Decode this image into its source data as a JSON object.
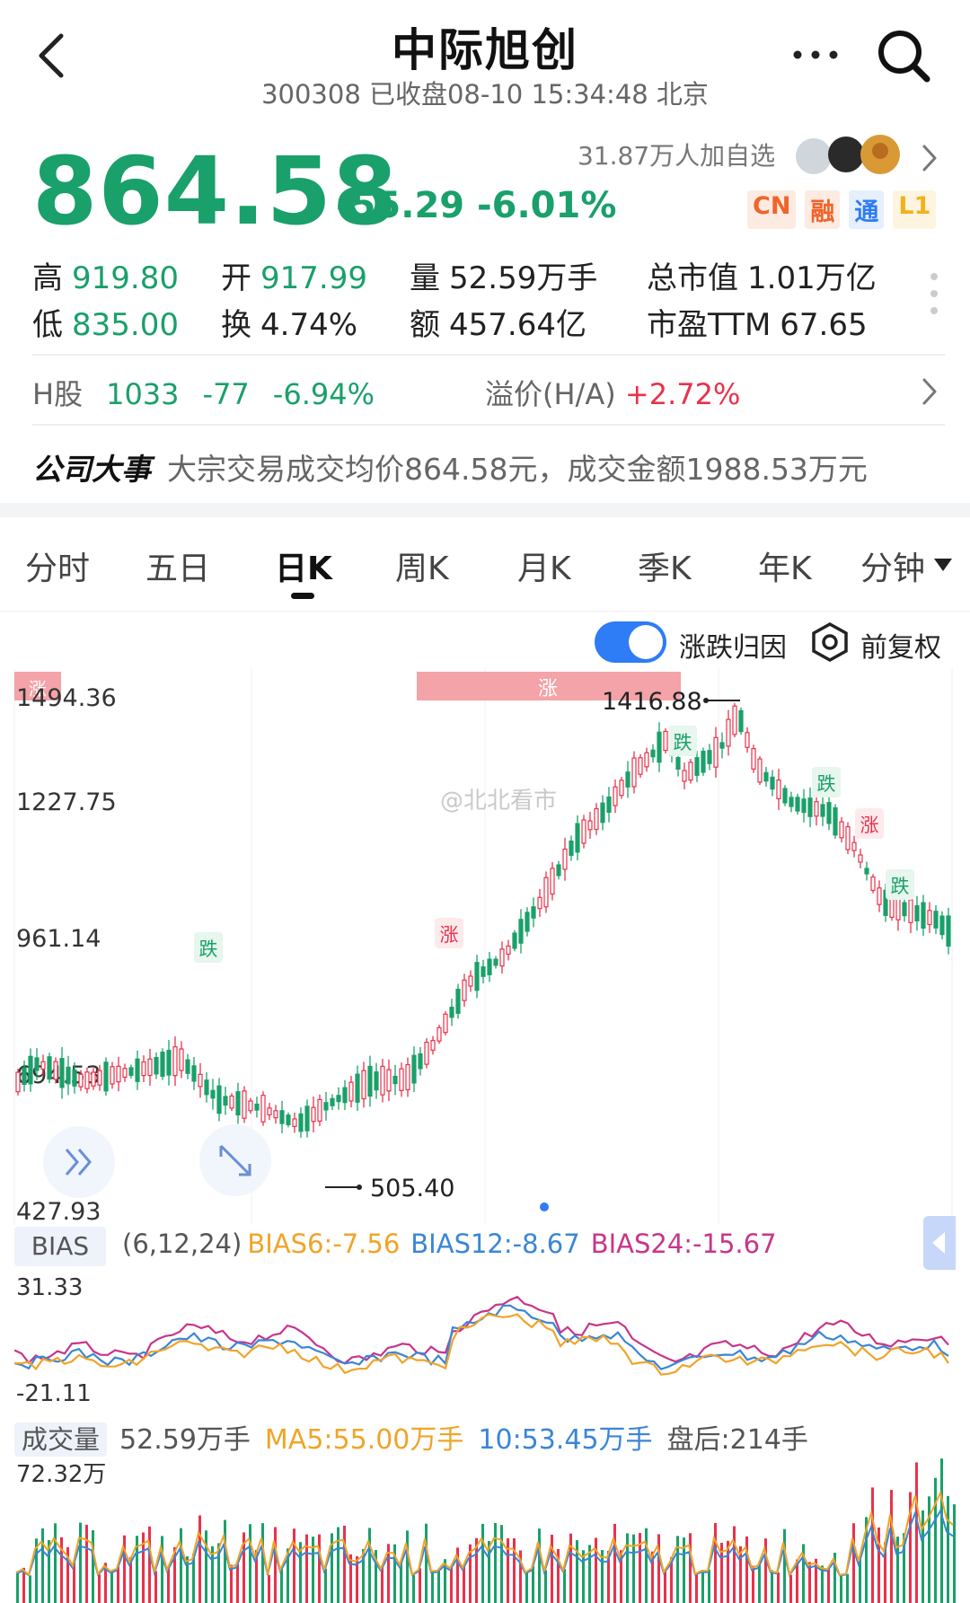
{
  "header": {
    "title": "中际旭创",
    "subtitle": "300308 已收盘08-10 15:34:48 北京",
    "back_icon": "chevron-left-icon",
    "more_icon": "more-horizontal-icon",
    "search_icon": "search-icon"
  },
  "quote": {
    "price": "864.58",
    "change": "-55.29 -6.01%",
    "watchers": "31.87万人加自选",
    "badges": [
      {
        "label": "CN",
        "color": "#f0642a",
        "bg": "#fdebe2"
      },
      {
        "label": "融",
        "color": "#f0642a",
        "bg": "#fdebe2"
      },
      {
        "label": "通",
        "color": "#2e7cf6",
        "bg": "#e6effd"
      },
      {
        "label": "L1",
        "color": "#f2b01e",
        "bg": "#fdf5e0"
      }
    ],
    "colors": {
      "down": "#1aa06a",
      "up": "#e8324b"
    }
  },
  "stats": {
    "high_label": "高",
    "high": "919.80",
    "open_label": "开",
    "open": "917.99",
    "volume_label": "量",
    "volume": "52.59万手",
    "mcap_label": "总市值",
    "mcap": "1.01万亿",
    "low_label": "低",
    "low": "835.00",
    "turnover_label": "换",
    "turnover": "4.74%",
    "amount_label": "额",
    "amount": "457.64亿",
    "pe_label": "市盈TTM",
    "pe": "67.65"
  },
  "hshare": {
    "label": "H股",
    "price": "1033",
    "change": "-77",
    "pct": "-6.94%",
    "premium_label": "溢价(H/A)",
    "premium": "+2.72%"
  },
  "event": {
    "label": "公司大事",
    "text": "大宗交易成交均价864.58元，成交金额1988.53万元"
  },
  "tabs": [
    "分时",
    "五日",
    "日K",
    "周K",
    "月K",
    "季K",
    "年K",
    "分钟"
  ],
  "active_tab": "日K",
  "controls": {
    "toggle_label": "涨跌归因",
    "adjust_label": "前复权"
  },
  "kline": {
    "y_ticks": [
      "1494.36",
      "1227.75",
      "961.14",
      "694.53",
      "427.93"
    ],
    "high_label": "1416.88",
    "low_label": "505.40",
    "tags": [
      {
        "text": "跌",
        "kind": "down"
      },
      {
        "text": "涨",
        "kind": "up"
      },
      {
        "text": "跌",
        "kind": "down"
      },
      {
        "text": "跌",
        "kind": "down"
      },
      {
        "text": "涨",
        "kind": "up"
      },
      {
        "text": "跌",
        "kind": "down"
      }
    ],
    "banner_left": "涨",
    "banner_mid": "涨",
    "watermark": "@北北看市"
  },
  "bias": {
    "name": "BIAS",
    "params": "(6,12,24)",
    "b6": "BIAS6:-7.56",
    "b12": "BIAS12:-8.67",
    "b24": "BIAS24:-15.67",
    "colors": {
      "b6": "#f0a428",
      "b12": "#3a86d6",
      "b24": "#c8358a"
    },
    "y_top": "31.33",
    "y_bottom": "-21.11"
  },
  "volume": {
    "name": "成交量",
    "value": "52.59万手",
    "ma5": "MA5:55.00万手",
    "ma10": "10:53.45万手",
    "after": "盘后:214手",
    "y_top": "72.32万"
  }
}
